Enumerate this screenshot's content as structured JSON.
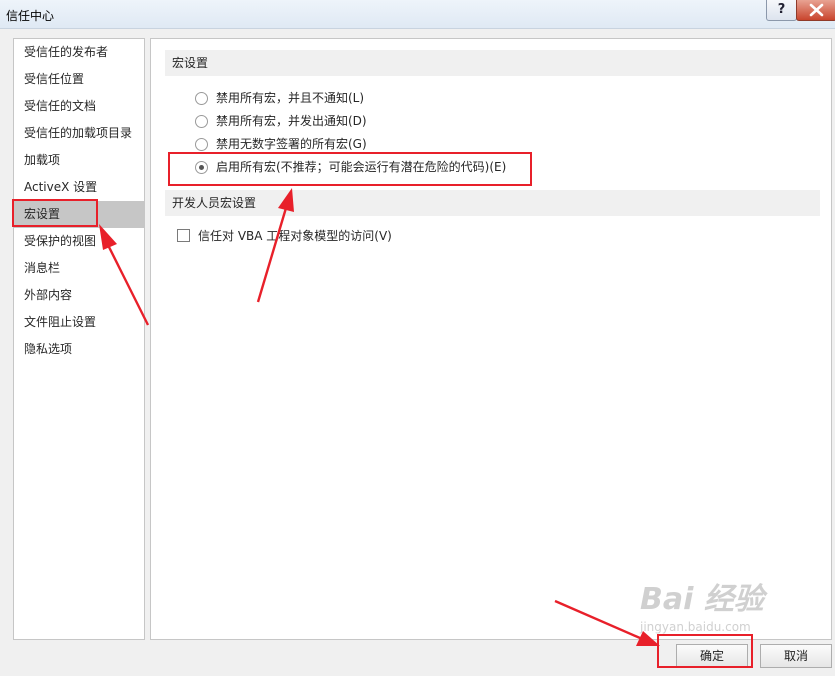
{
  "window": {
    "title": "信任中心",
    "help_label": "?"
  },
  "sidebar": {
    "items": [
      {
        "label": "受信任的发布者"
      },
      {
        "label": "受信任位置"
      },
      {
        "label": "受信任的文档"
      },
      {
        "label": "受信任的加载项目录"
      },
      {
        "label": "加载项"
      },
      {
        "label": "ActiveX 设置"
      },
      {
        "label": "宏设置",
        "selected": true
      },
      {
        "label": "受保护的视图"
      },
      {
        "label": "消息栏"
      },
      {
        "label": "外部内容"
      },
      {
        "label": "文件阻止设置"
      },
      {
        "label": "隐私选项"
      }
    ]
  },
  "macro_settings": {
    "header": "宏设置",
    "options": [
      {
        "label": "禁用所有宏，并且不通知(L)",
        "checked": false
      },
      {
        "label": "禁用所有宏，并发出通知(D)",
        "checked": false
      },
      {
        "label": "禁用无数字签署的所有宏(G)",
        "checked": false
      },
      {
        "label": "启用所有宏(不推荐；可能会运行有潜在危险的代码)(E)",
        "checked": true
      }
    ]
  },
  "developer_settings": {
    "header": "开发人员宏设置",
    "trust_vba_label": "信任对 VBA 工程对象模型的访问(V)",
    "trust_vba_checked": false
  },
  "buttons": {
    "ok_label": "确定",
    "cancel_label": "取消"
  },
  "watermark": {
    "text": "Bai 经验",
    "subtext": "jingyan.baidu.com"
  },
  "colors": {
    "annotation_red": "#e8202a",
    "selected_bg": "#c6c6c6"
  }
}
